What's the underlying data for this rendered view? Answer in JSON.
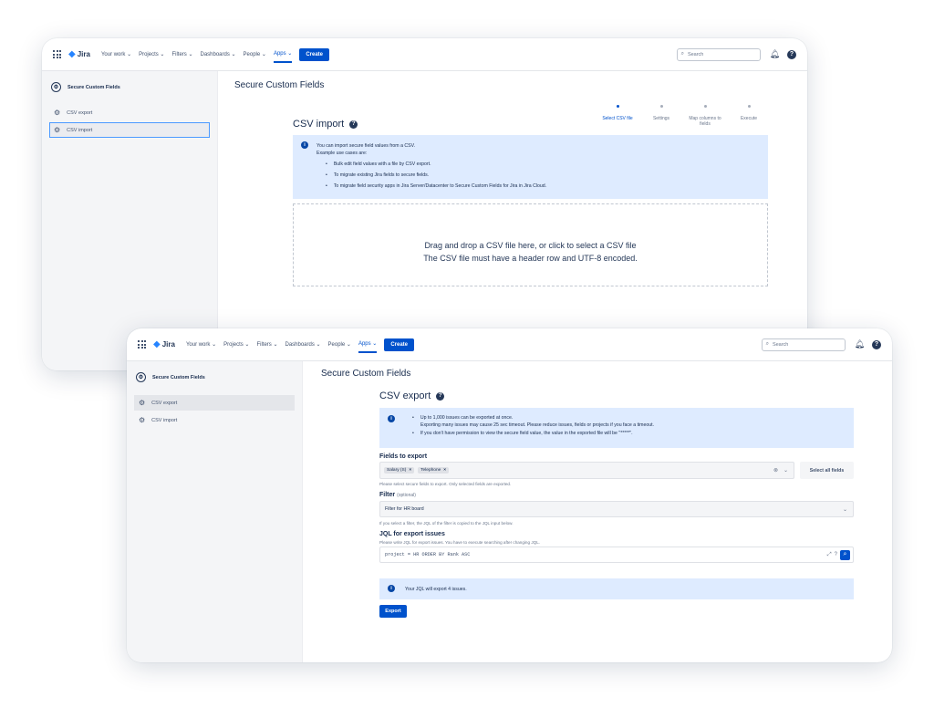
{
  "nav": {
    "logo": "Jira",
    "items": [
      "Your work ⌄",
      "Projects ⌄",
      "Filters ⌄",
      "Dashboards ⌄",
      "People ⌄",
      "Apps ⌄"
    ],
    "create": "Create",
    "search_placeholder": "Search"
  },
  "sidebar": {
    "app_name": "Secure Custom Fields",
    "items": [
      "CSV export",
      "CSV import"
    ]
  },
  "page_title": "Secure Custom Fields",
  "import": {
    "title": "CSV import",
    "steps": [
      "Select CSV file",
      "Settings",
      "Map columns to fields",
      "Execute"
    ],
    "info_line1": "You can import secure field values from a CSV.",
    "info_line2": "Example use cases are:",
    "bullets": [
      "Bulk edit field values with a file by CSV export.",
      "To migrate existing Jira fields to secure fields.",
      "To migrate field security apps in Jira Server/Datacenter to Secure Custom Fields for Jira in Jira Cloud."
    ],
    "drop_line1": "Drag and drop a CSV file here, or click to select a CSV file",
    "drop_line2": "The CSV file must have a header row and UTF-8 encoded."
  },
  "export": {
    "title": "CSV export",
    "info_bullet1": "Up to 1,000 issues can be exported at once.",
    "info_sub": "Exporting many issues may cause 25 sec timeout. Please reduce issues, fields or projects if you face a timeout.",
    "info_bullet2": "If you don't have permission to view the secure field value, the value in the exported file will be \"*****\".",
    "fields_label": "Fields to export",
    "tags": [
      "Salary (S)",
      "Telephone"
    ],
    "select_all": "Select all fields",
    "fields_help": "Please select secure fields to export. Only selected fields are exported.",
    "filter_label": "Filter",
    "filter_optional": "(optional)",
    "filter_value": "Filter for HR board",
    "filter_help": "If you select a filter, the JQL of the filter is copied to the JQL input below.",
    "jql_label": "JQL for export issues",
    "jql_help": "Please write JQL for export issues. You have to execute searching after changing JQL.",
    "jql_value": "project = HR ORDER BY Rank ASC",
    "result": "Your JQL will export 4 issues.",
    "export_button": "Export"
  },
  "colors": {
    "primary": "#0052cc",
    "info_bg": "#deebff",
    "sidebar_bg": "#f4f5f7"
  }
}
